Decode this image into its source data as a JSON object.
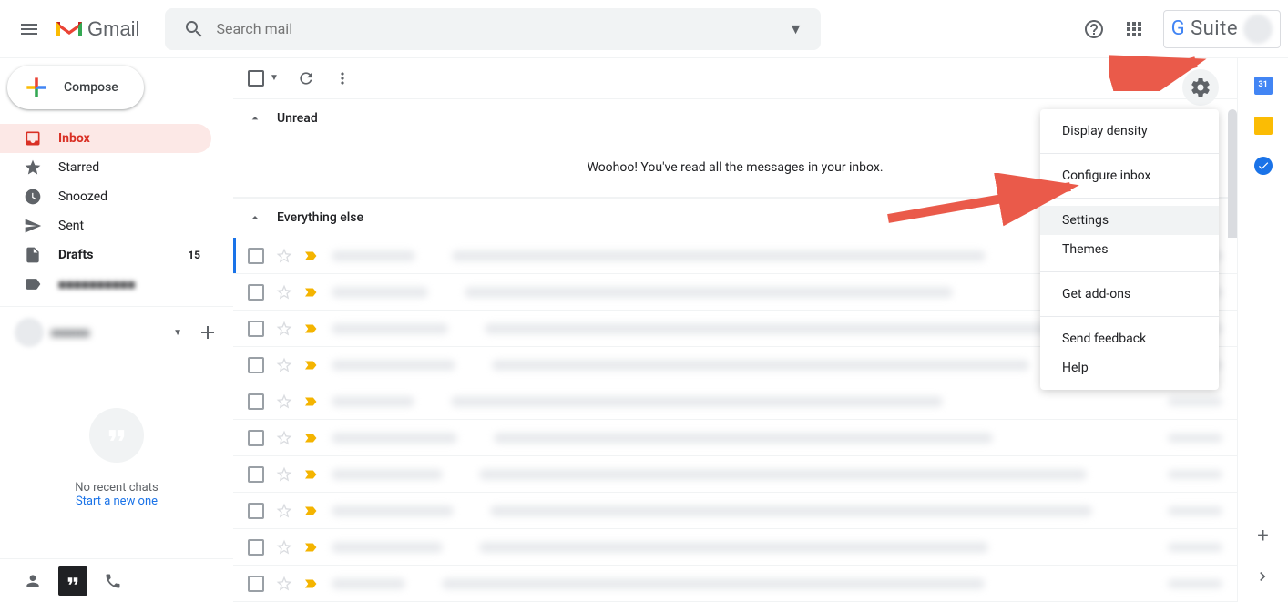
{
  "header": {
    "logo_text": "Gmail",
    "search_placeholder": "Search mail",
    "gsuite_text": "G Suite"
  },
  "sidebar": {
    "compose_label": "Compose",
    "items": [
      {
        "label": "Inbox",
        "icon": "inbox",
        "active": true
      },
      {
        "label": "Starred",
        "icon": "star"
      },
      {
        "label": "Snoozed",
        "icon": "clock"
      },
      {
        "label": "Sent",
        "icon": "send"
      },
      {
        "label": "Drafts",
        "icon": "file",
        "count": "15",
        "bold": true
      },
      {
        "label": "■■■■■■■■■■",
        "icon": "label",
        "blur": true
      }
    ],
    "hangouts_empty_text": "No recent chats",
    "hangouts_empty_link": "Start a new one"
  },
  "content": {
    "sections": [
      {
        "title": "Unread",
        "empty_message": "Woohoo! You've read all the messages in your inbox."
      },
      {
        "title": "Everything else"
      }
    ],
    "mail_count": 10
  },
  "settings_menu": {
    "items": [
      {
        "label": "Display density"
      },
      {
        "label": "Configure inbox",
        "sep_after": true
      },
      {
        "label": "Settings",
        "highlighted": true
      },
      {
        "label": "Themes",
        "sep_after": true
      },
      {
        "label": "Get add-ons",
        "sep_after": true
      },
      {
        "label": "Send feedback"
      },
      {
        "label": "Help"
      }
    ]
  }
}
